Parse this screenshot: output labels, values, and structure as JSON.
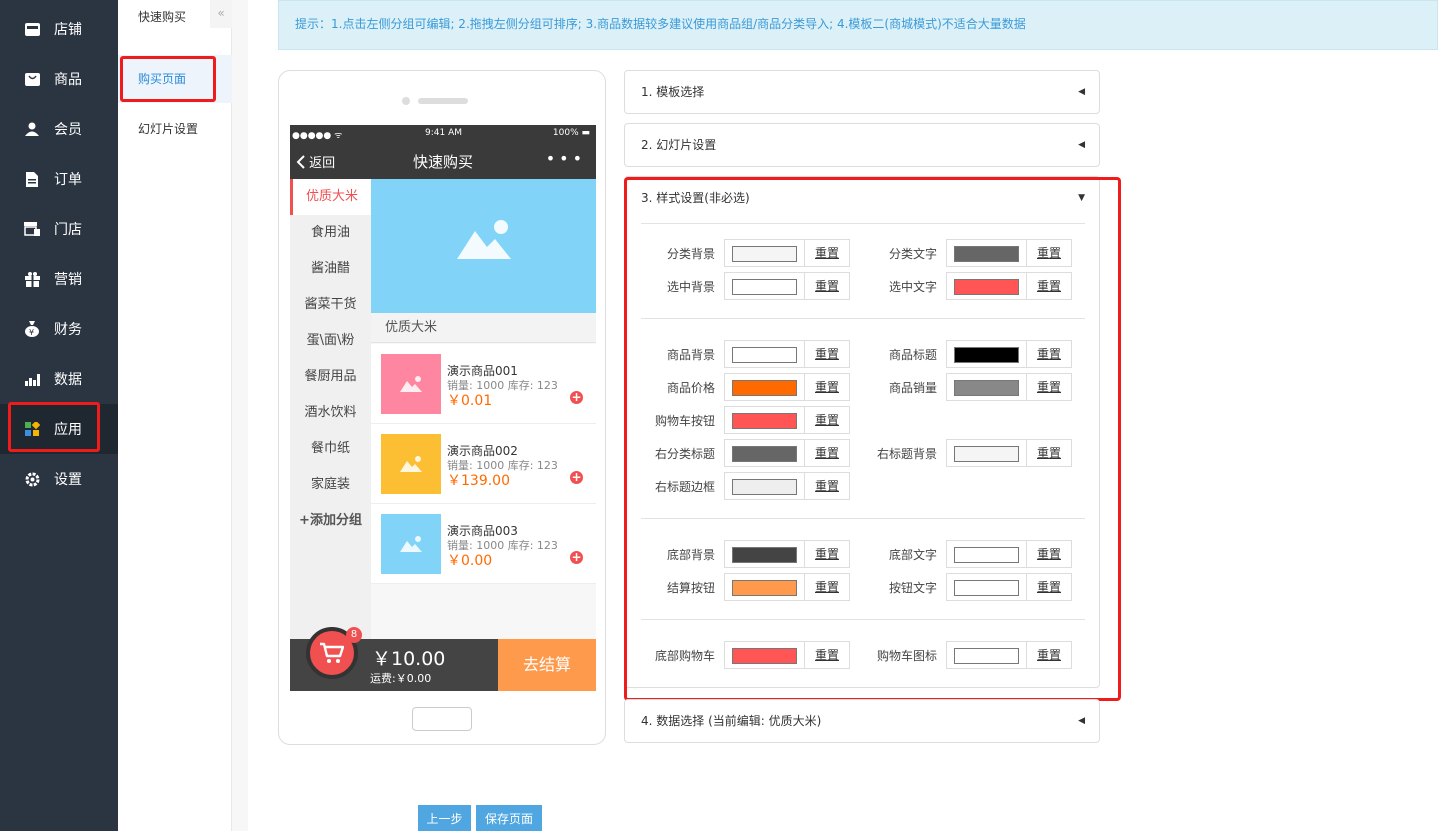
{
  "nav": {
    "items": [
      {
        "label": "店铺",
        "icon": "store-icon"
      },
      {
        "label": "商品",
        "icon": "goods-icon"
      },
      {
        "label": "会员",
        "icon": "member-icon"
      },
      {
        "label": "订单",
        "icon": "order-icon"
      },
      {
        "label": "门店",
        "icon": "shop-icon"
      },
      {
        "label": "营销",
        "icon": "gift-icon"
      },
      {
        "label": "财务",
        "icon": "money-icon"
      },
      {
        "label": "数据",
        "icon": "chart-icon"
      },
      {
        "label": "应用",
        "icon": "apps-icon"
      },
      {
        "label": "设置",
        "icon": "gear-icon"
      }
    ],
    "active": "应用"
  },
  "subnav": {
    "head": "快速购买",
    "collapse": "«",
    "items": [
      "购买页面",
      "幻灯片设置"
    ]
  },
  "tip": "提示：1.点击左侧分组可编辑; 2.拖拽左侧分组可排序; 3.商品数据较多建议使用商品组/商品分类导入; 4.模板二(商城模式)不适合大量数据",
  "phone": {
    "status": {
      "left": "●●●●● ᯤ",
      "time": "9:41 AM",
      "battery": "100% ▬"
    },
    "back": "返回",
    "title": "快速购买",
    "more": "•••",
    "categories": [
      "优质大米",
      "食用油",
      "酱油醋",
      "酱菜干货",
      "蛋\\面\\粉",
      "餐厨用品",
      "酒水饮料",
      "餐巾纸",
      "家庭装",
      "+添加分组"
    ],
    "right_title": "优质大米",
    "goods": [
      {
        "name": "演示商品001",
        "meta": "销量: 1000 库存: 123",
        "price": "￥0.01",
        "color": "#ff86a0"
      },
      {
        "name": "演示商品002",
        "meta": "销量: 1000 库存: 123",
        "price": "￥139.00",
        "color": "#fcbf33"
      },
      {
        "name": "演示商品003",
        "meta": "销量: 1000 库存: 123",
        "price": "￥0.00",
        "color": "#81d3f8"
      }
    ],
    "cart_count": "8",
    "total": "￥10.00",
    "shipping": "运费:￥0.00",
    "pay": "去结算"
  },
  "panels": {
    "p1": "1. 模板选择",
    "p2": "2. 幻灯片设置",
    "p3": "3. 样式设置(非必选)",
    "p4": "4. 数据选择 (当前编辑: 优质大米)"
  },
  "reset_label": "重置",
  "styles": [
    {
      "label": "分类背景",
      "color": "#f5f5f5"
    },
    {
      "label": "分类文字",
      "color": "#666666"
    },
    {
      "label": "选中背景",
      "color": "#ffffff"
    },
    {
      "label": "选中文字",
      "color": "#ff5555"
    },
    {
      "label": "商品背景",
      "color": "#ffffff"
    },
    {
      "label": "商品标题",
      "color": "#000000"
    },
    {
      "label": "商品价格",
      "color": "#ff6a00"
    },
    {
      "label": "商品销量",
      "color": "#888888"
    },
    {
      "label": "购物车按钮",
      "color": "#ff5555"
    },
    {
      "label": "右分类标题",
      "color": "#666666"
    },
    {
      "label": "右标题背景",
      "color": "#f5f5f5"
    },
    {
      "label": "右标题边框",
      "color": "#eeeeee"
    },
    {
      "label": "底部背景",
      "color": "#444444"
    },
    {
      "label": "底部文字",
      "color": "#ffffff"
    },
    {
      "label": "结算按钮",
      "color": "#ff9a4c"
    },
    {
      "label": "按钮文字",
      "color": "#ffffff"
    },
    {
      "label": "底部购物车",
      "color": "#ff5555"
    },
    {
      "label": "购物车图标",
      "color": "#ffffff"
    }
  ],
  "buttons": {
    "prev": "上一步",
    "save": "保存页面"
  }
}
